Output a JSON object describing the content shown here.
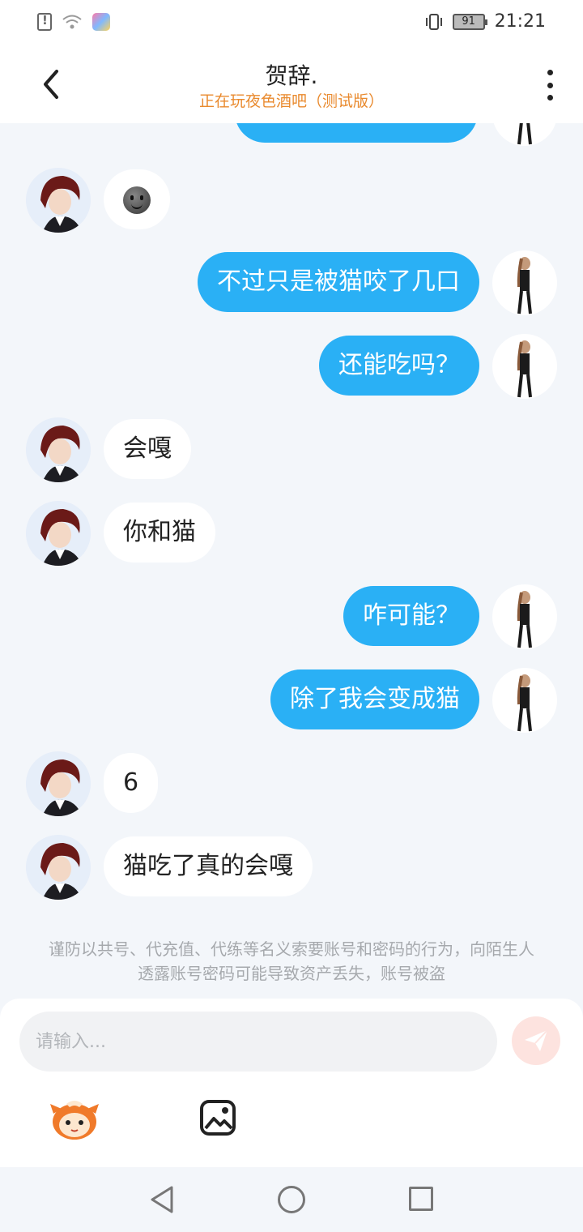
{
  "status_bar": {
    "time": "21:21",
    "battery": "91"
  },
  "header": {
    "title": "贺辞.",
    "subtitle": "正在玩夜色酒吧（测试版）"
  },
  "messages": [
    {
      "side": "left",
      "text": ""
    },
    {
      "side": "right",
      "text": "不过只是被猫咬了几口"
    },
    {
      "side": "right",
      "text": "还能吃吗？"
    },
    {
      "side": "left",
      "text": "会嘎"
    },
    {
      "side": "left",
      "text": "你和猫"
    },
    {
      "side": "right",
      "text": "咋可能？"
    },
    {
      "side": "right",
      "text": "除了我会变成猫"
    },
    {
      "side": "left",
      "text": "6"
    },
    {
      "side": "left",
      "text": "猫吃了真的会嘎"
    }
  ],
  "notice": "谨防以共号、代充值、代练等名义索要账号和密码的行为，向陌生人透露账号密码可能导致资产丢失，账号被盗",
  "input": {
    "placeholder": "请输入..."
  },
  "colors": {
    "accent_blue": "#2ab0f5",
    "subtitle_orange": "#e98a2e",
    "send_pink": "#fde3df"
  }
}
